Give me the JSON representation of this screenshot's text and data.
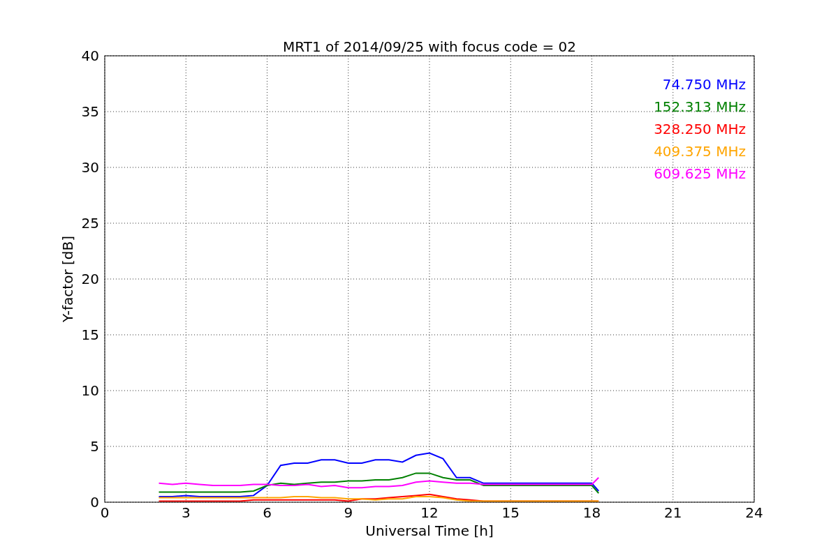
{
  "chart_data": {
    "type": "line",
    "title": "MRT1 of 2014/09/25 with focus code = 02",
    "xlabel": "Universal Time [h]",
    "ylabel": "Y-factor [dB]",
    "x": [
      2,
      2.5,
      3,
      3.5,
      4,
      4.5,
      5,
      5.5,
      6,
      6.5,
      7,
      7.5,
      8,
      8.5,
      9,
      9.5,
      10,
      10.5,
      11,
      11.5,
      12,
      12.5,
      13,
      13.5,
      14,
      18,
      18.25
    ],
    "series": [
      {
        "name": "74.750 MHz",
        "color": "#0000ff",
        "values": [
          0.5,
          0.5,
          0.6,
          0.5,
          0.5,
          0.5,
          0.5,
          0.6,
          1.5,
          3.3,
          3.5,
          3.5,
          3.8,
          3.8,
          3.5,
          3.5,
          3.8,
          3.8,
          3.6,
          4.2,
          4.4,
          3.9,
          2.2,
          2.2,
          1.7,
          1.7,
          1.0
        ]
      },
      {
        "name": "152.313 MHz",
        "color": "#008000",
        "values": [
          0.9,
          0.9,
          0.9,
          0.9,
          0.9,
          0.9,
          0.9,
          1.0,
          1.5,
          1.7,
          1.6,
          1.7,
          1.8,
          1.8,
          1.9,
          1.9,
          2.0,
          2.0,
          2.2,
          2.6,
          2.6,
          2.2,
          2.0,
          2.0,
          1.5,
          1.5,
          0.8
        ]
      },
      {
        "name": "328.250 MHz",
        "color": "#ff0000",
        "values": [
          0.1,
          0.1,
          0.1,
          0.1,
          0.1,
          0.1,
          0.1,
          0.2,
          0.2,
          0.2,
          0.2,
          0.2,
          0.2,
          0.2,
          0.1,
          0.3,
          0.3,
          0.4,
          0.5,
          0.6,
          0.7,
          0.5,
          0.3,
          0.2,
          0.1,
          0.1,
          0.1
        ]
      },
      {
        "name": "409.375 MHz",
        "color": "#ffa500",
        "values": [
          0.4,
          0.4,
          0.4,
          0.4,
          0.4,
          0.4,
          0.4,
          0.4,
          0.4,
          0.4,
          0.5,
          0.5,
          0.4,
          0.4,
          0.3,
          0.3,
          0.2,
          0.3,
          0.3,
          0.5,
          0.5,
          0.4,
          0.2,
          0.1,
          0.1,
          0.1,
          0.1
        ]
      },
      {
        "name": "609.625 MHz",
        "color": "#ff00ff",
        "values": [
          1.7,
          1.6,
          1.7,
          1.6,
          1.5,
          1.5,
          1.5,
          1.6,
          1.6,
          1.5,
          1.5,
          1.6,
          1.4,
          1.5,
          1.3,
          1.3,
          1.4,
          1.4,
          1.5,
          1.8,
          1.9,
          1.8,
          1.7,
          1.7,
          1.6,
          1.6,
          2.2
        ]
      }
    ],
    "grid": true,
    "xlim": [
      0,
      24
    ],
    "ylim": [
      0,
      40
    ],
    "xticks": [
      0,
      3,
      6,
      9,
      12,
      15,
      18,
      21,
      24
    ],
    "yticks": [
      0,
      5,
      10,
      15,
      20,
      25,
      30,
      35,
      40
    ]
  }
}
